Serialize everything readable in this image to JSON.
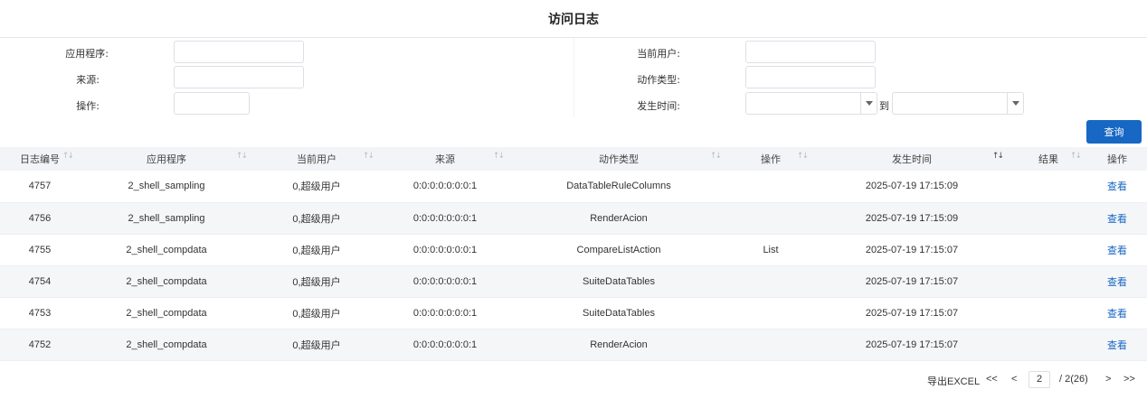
{
  "title": "访问日志",
  "filters": {
    "app_label": "应用程序:",
    "source_label": "来源:",
    "op_label": "操作:",
    "user_label": "当前用户:",
    "action_label": "动作类型:",
    "time_label": "发生时间:",
    "to_label": "到",
    "app_value": "",
    "source_value": "",
    "op_value": "",
    "user_value": "",
    "action_value": "",
    "time_from": "",
    "time_to": ""
  },
  "query_button": "查询",
  "table": {
    "columns": [
      "日志编号",
      "应用程序",
      "当前用户",
      "来源",
      "动作类型",
      "操作",
      "发生时间",
      "结果",
      "操作"
    ],
    "rows": [
      {
        "id": "4757",
        "app": "2_shell_sampling",
        "user": "0,超级用户",
        "source": "0:0:0:0:0:0:0:1",
        "action": "DataTableRuleColumns",
        "op": "",
        "time": "2025-07-19 17:15:09",
        "result": "",
        "link": "查看"
      },
      {
        "id": "4756",
        "app": "2_shell_sampling",
        "user": "0,超级用户",
        "source": "0:0:0:0:0:0:0:1",
        "action": "RenderAcion",
        "op": "",
        "time": "2025-07-19 17:15:09",
        "result": "",
        "link": "查看"
      },
      {
        "id": "4755",
        "app": "2_shell_compdata",
        "user": "0,超级用户",
        "source": "0:0:0:0:0:0:0:1",
        "action": "CompareListAction",
        "op": "List",
        "time": "2025-07-19 17:15:07",
        "result": "",
        "link": "查看"
      },
      {
        "id": "4754",
        "app": "2_shell_compdata",
        "user": "0,超级用户",
        "source": "0:0:0:0:0:0:0:1",
        "action": "SuiteDataTables",
        "op": "",
        "time": "2025-07-19 17:15:07",
        "result": "",
        "link": "查看"
      },
      {
        "id": "4753",
        "app": "2_shell_compdata",
        "user": "0,超级用户",
        "source": "0:0:0:0:0:0:0:1",
        "action": "SuiteDataTables",
        "op": "",
        "time": "2025-07-19 17:15:07",
        "result": "",
        "link": "查看"
      },
      {
        "id": "4752",
        "app": "2_shell_compdata",
        "user": "0,超级用户",
        "source": "0:0:0:0:0:0:0:1",
        "action": "RenderAcion",
        "op": "",
        "time": "2025-07-19 17:15:07",
        "result": "",
        "link": "查看"
      }
    ]
  },
  "pager": {
    "export": "导出EXCEL",
    "first": "<<",
    "prev": "<",
    "current": "2",
    "total": "/ 2(26)",
    "next": ">",
    "last": ">>"
  },
  "colors": {
    "accent": "#1767c4",
    "header_bg": "#f2f4f7",
    "stripe": "#f5f6f8"
  }
}
